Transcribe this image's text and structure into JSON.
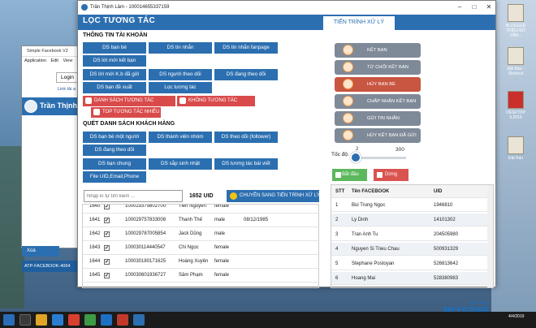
{
  "window": {
    "title": "Trần Thịnh Lâm - 100014655337159"
  },
  "tabs": {
    "left": "LỌC TƯƠNG TÁC",
    "right": "TIẾN TRÌNH XỬ LÝ"
  },
  "account_section": {
    "title": "THÔNG TIN TÀI KHOẢN",
    "buttons": [
      "DS bạn bè",
      "DS tin nhắn",
      "DS tin nhắn fanpage",
      "DS lời mời kết bạn",
      "DS lời mời K.b đã gửi",
      "DS người theo dõi",
      "DS đang theo dõi",
      "DS bạn đề xuất",
      "Lọc tương tác"
    ],
    "tags": [
      "DANH SÁCH TƯƠNG TÁC",
      "KHÔNG TƯƠNG TÁC",
      "TOP TƯƠNG TÁC NHIỀU"
    ]
  },
  "scan_section": {
    "title": "QUÉT DANH SÁCH KHÁCH HÀNG",
    "buttons": [
      "DS bạn bè một người",
      "DS thành viên nhóm",
      "DS theo dõi (follower)",
      "DS đang theo dõi",
      "DS bạn chung",
      "DS sắp sinh nhật",
      "DS tương tác bài viết",
      "File UID,Email,Phone"
    ]
  },
  "search": {
    "placeholder": "Nhập kí tự tìm kiếm ..."
  },
  "uid_count": "1652 UID",
  "transfer_button": "CHUYỂN SANG TIẾN TRÌNH XỬ LÝ",
  "left_table": {
    "rows": [
      {
        "n": "1640",
        "checked": "✔",
        "uid": "100029379802700",
        "name": "Tien Nguyen",
        "gender": "female",
        "birthday": ""
      },
      {
        "n": "1641",
        "checked": "✔",
        "uid": "100029757833008",
        "name": "Thanh Thế",
        "gender": "male",
        "birthday": "08/12/1985"
      },
      {
        "n": "1642",
        "checked": "✔",
        "uid": "100029787005854",
        "name": "Jack Dũng",
        "gender": "male",
        "birthday": ""
      },
      {
        "n": "1643",
        "checked": "✔",
        "uid": "100030114440547",
        "name": "Chi Ngọc",
        "gender": "female",
        "birthday": ""
      },
      {
        "n": "1644",
        "checked": "✔",
        "uid": "100030180171625",
        "name": "Hoàng Xuyên",
        "gender": "female",
        "birthday": ""
      },
      {
        "n": "1645",
        "checked": "✔",
        "uid": "100030601936727",
        "name": "Sâm Phạm",
        "gender": "female",
        "birthday": ""
      }
    ]
  },
  "actions": [
    "KẾT BẠN",
    "TỪ CHỐI KẾT BẠN",
    "HỦY BẠN BÈ",
    "CHẤP NHẬN KẾT BẠN",
    "GỬI TIN NHẮN",
    "HỦY KẾT BẠN ĐÃ GỬI"
  ],
  "speed": {
    "label": "Tốc độ:",
    "min": "2",
    "max": "300",
    "value": 2
  },
  "start_button": "Bắt đầu",
  "stop_button": "Dừng",
  "right_table": {
    "headers": [
      "STT",
      "Tên FACEBOOK",
      "UID"
    ],
    "rows": [
      {
        "stt": "1",
        "name": "Bùi Trung Ngọc",
        "uid": "1946810"
      },
      {
        "stt": "2",
        "name": "Ly Dinh",
        "uid": "14101302"
      },
      {
        "stt": "3",
        "name": "Tran Anh Tu",
        "uid": "204505980"
      },
      {
        "stt": "4",
        "name": "Nguyen Si Trieu Chau",
        "uid": "500931329"
      },
      {
        "stt": "5",
        "name": "Stephane Postoyan",
        "uid": "526813642"
      },
      {
        "stt": "6",
        "name": "Hoang Mai",
        "uid": "528380983"
      }
    ]
  },
  "back_window": {
    "title": "Simple Facebook V2",
    "menu": [
      "Application",
      "Edit",
      "View"
    ],
    "login": "Login",
    "link": "Link tải a",
    "user": "Trần Thịnh L",
    "delete": "Xoá",
    "account": "ATP-FACEBOOK-4064"
  },
  "desktop_icons": [
    {
      "label": "BLOGGER TRIỆU ĐÔ VĂN..."
    },
    {
      "label": "Đặt Báo - Shortcut"
    },
    {
      "label": "DESKTOP 9.2019"
    },
    {
      "label": "Đặt Báo"
    }
  ],
  "taskbar": {
    "time": "4/4/2019"
  },
  "watermark": {
    "text": "POS365",
    "sub": "1900 4515"
  }
}
